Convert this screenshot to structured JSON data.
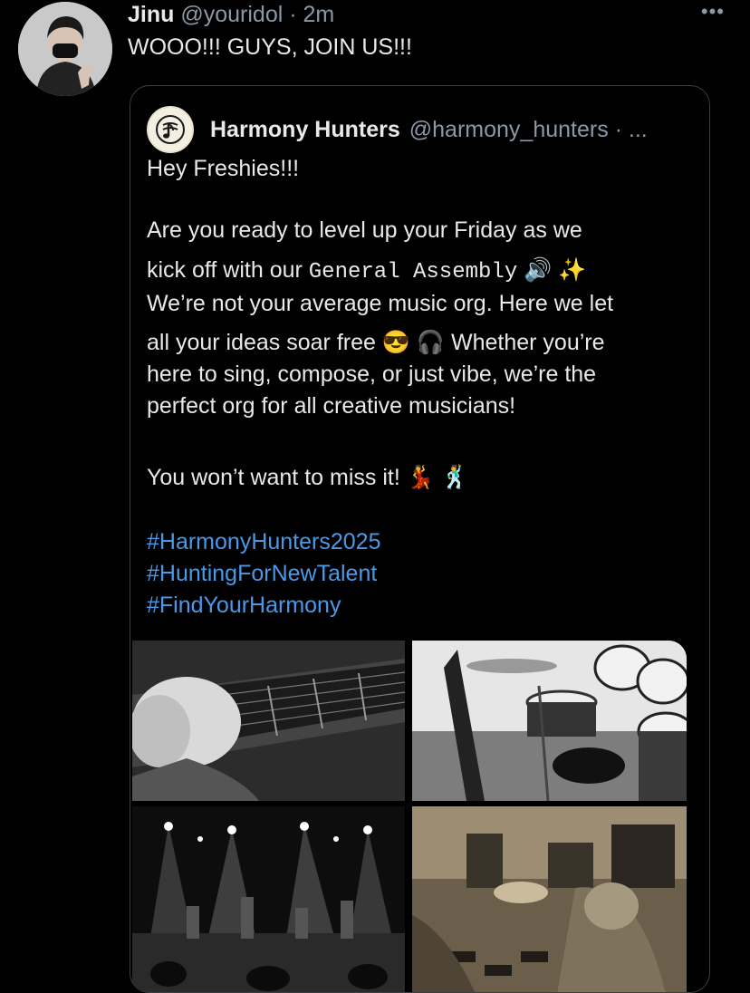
{
  "author": {
    "name": "Jinu",
    "handle": "@youridol",
    "separator": "·",
    "time": "2m"
  },
  "more_icon": "more-dots-icon",
  "more_glyph": "•••",
  "tweet_text": "WOOO!!! GUYS, JOIN US!!!",
  "quoted": {
    "name": "Harmony Hunters",
    "handle": "@harmony_hunters · ...",
    "logo_icon": "music-note-logo-icon",
    "greeting": "Hey Freshies!!!",
    "line1": "Are you ready to level up your Friday as we",
    "line2_pre": "kick off with our ",
    "line2_mono": "General Assembly",
    "line2_emoji": " 🔊 ✨",
    "line3": "We’re not your average music org. Here we let",
    "line4": "all your ideas soar free 😎 🎧  Whether you’re",
    "line5": "here to sing, compose, or just vibe, we’re the",
    "line6": "perfect org for all creative musicians!",
    "closing": "You won’t want to miss it! 💃 🕺",
    "hashtags": [
      "#HarmonyHunters2025",
      "#HuntingForNewTalent",
      "#FindYourHarmony"
    ]
  },
  "media": [
    {
      "name": "guitar-closeup-photo"
    },
    {
      "name": "drum-kit-photo"
    },
    {
      "name": "band-on-stage-photo"
    },
    {
      "name": "band-practice-photo"
    }
  ]
}
